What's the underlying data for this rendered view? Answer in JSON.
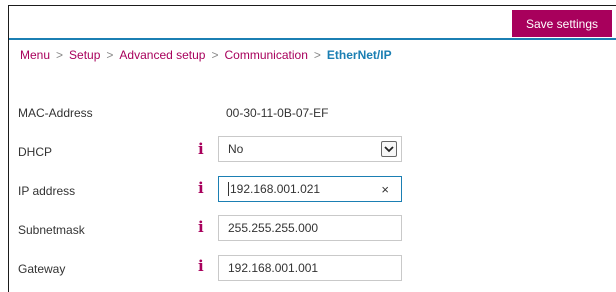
{
  "toolbar": {
    "save_label": "Save settings"
  },
  "breadcrumb": {
    "items": [
      "Menu",
      "Setup",
      "Advanced setup",
      "Communication",
      "EtherNet/IP"
    ],
    "separator": ">"
  },
  "mac": {
    "label": "MAC-Address",
    "value": "00-30-11-0B-07-EF"
  },
  "dhcp": {
    "label": "DHCP",
    "info": "i",
    "value": "No"
  },
  "ip": {
    "label": "IP address",
    "info": "i",
    "value": "192.168.001.021",
    "clear": "×"
  },
  "subnet": {
    "label": "Subnetmask",
    "info": "i",
    "value": "255.255.255.000"
  },
  "gateway": {
    "label": "Gateway",
    "info": "i",
    "value": "192.168.001.001"
  },
  "colors": {
    "accent": "#a8005c",
    "link_active": "#1b7fb3",
    "divider": "#1b7fb3"
  }
}
